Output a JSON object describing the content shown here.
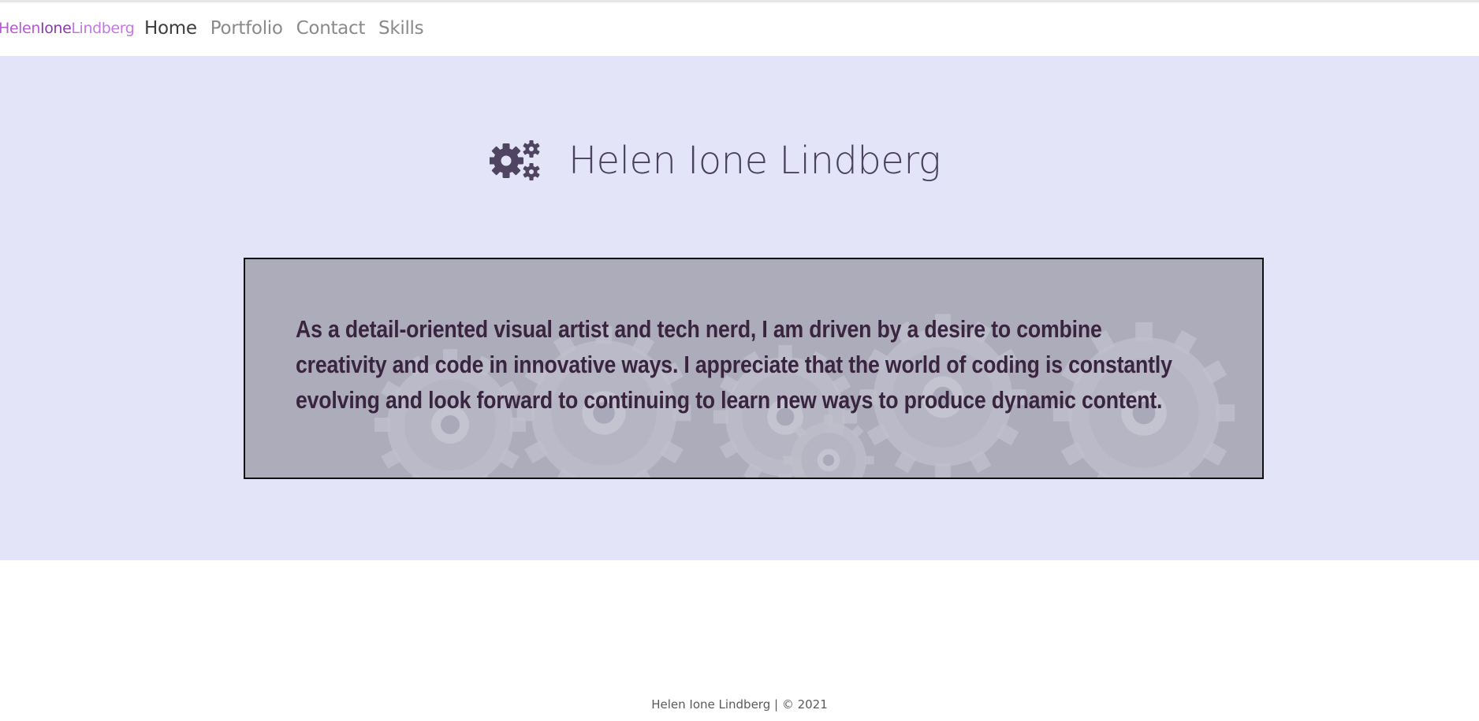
{
  "brand": {
    "part1": "Helen",
    "part2": "Ione",
    "part3": "Lindberg"
  },
  "nav": [
    {
      "label": "Home",
      "active": true
    },
    {
      "label": "Portfolio",
      "active": false
    },
    {
      "label": "Contact",
      "active": false
    },
    {
      "label": "Skills",
      "active": false
    }
  ],
  "hero": {
    "icon": "gears-icon",
    "title": "Helen Ione Lindberg"
  },
  "about": {
    "text": "As a detail-oriented visual artist and tech nerd, I am driven by a desire to combine creativity and code in innovative ways. I appreciate that the world of coding is constantly evolving and look forward to continuing to learn new ways to produce dynamic content."
  },
  "footer": {
    "text": "Helen Ione Lindberg | © 2021"
  },
  "colors": {
    "hero_bg": "#e4e4f8",
    "card_bg": "#adadba",
    "text_dark": "#3a2540",
    "title": "#4a405f",
    "brand_purple": "#b55bd1"
  }
}
